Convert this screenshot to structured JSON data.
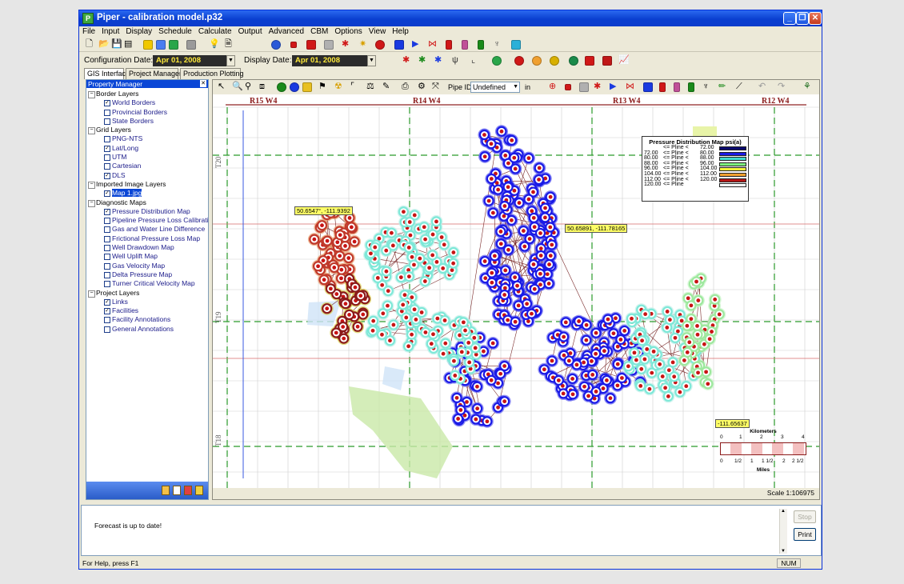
{
  "window": {
    "title": "Piper - calibration model.p32",
    "app_icon": "P"
  },
  "menu": [
    "File",
    "Input",
    "Display",
    "Schedule",
    "Calculate",
    "Output",
    "Advanced",
    "CBM",
    "Options",
    "View",
    "Help"
  ],
  "config": {
    "configuration_label": "Configuration Date:",
    "configuration_date": "Apr 01, 2008",
    "display_label": "Display Date:",
    "display_date": "Apr 01, 2008"
  },
  "tabs": [
    "GIS Interface",
    "Project Manager",
    "Production Plotting"
  ],
  "property_manager": {
    "title": "Property Manager",
    "groups": [
      {
        "label": "Border Layers",
        "items": [
          {
            "label": "World Borders",
            "checked": true
          },
          {
            "label": "Provincial Borders",
            "checked": false
          },
          {
            "label": "State Borders",
            "checked": false
          }
        ]
      },
      {
        "label": "Grid Layers",
        "items": [
          {
            "label": "PNG-NTS",
            "checked": false
          },
          {
            "label": "Lat/Long",
            "checked": true
          },
          {
            "label": "UTM",
            "checked": false
          },
          {
            "label": "Cartesian",
            "checked": false
          },
          {
            "label": "DLS",
            "checked": true
          }
        ]
      },
      {
        "label": "Imported Image Layers",
        "items": [
          {
            "label": "Map 1.jpg",
            "checked": true,
            "selected": true
          }
        ]
      },
      {
        "label": "Diagnostic Maps",
        "items": [
          {
            "label": "Pressure Distribution Map",
            "checked": true
          },
          {
            "label": "Pipeline Pressure Loss Calibration",
            "checked": false
          },
          {
            "label": "Gas and Water Line Difference",
            "checked": false
          },
          {
            "label": "Frictional Pressure Loss Map",
            "checked": false
          },
          {
            "label": "Well Drawdown Map",
            "checked": false
          },
          {
            "label": "Well Uplift Map",
            "checked": false
          },
          {
            "label": "Gas Velocity Map",
            "checked": false
          },
          {
            "label": "Delta Pressure Map",
            "checked": false
          },
          {
            "label": "Turner Critical Velocity Map",
            "checked": false
          }
        ]
      },
      {
        "label": "Project Layers",
        "items": [
          {
            "label": "Links",
            "checked": true
          },
          {
            "label": "Facilities",
            "checked": true
          },
          {
            "label": "Facility Annotations",
            "checked": false
          },
          {
            "label": "General Annotations",
            "checked": false
          }
        ]
      }
    ]
  },
  "map_toolbar": {
    "pipe_id_label": "Pipe ID:",
    "pipe_id_value": "Undefined",
    "unit": "in"
  },
  "map": {
    "range_labels": [
      "R15 W4",
      "R14 W4",
      "R13 W4",
      "R12 W4"
    ],
    "township_labels": [
      "T20",
      "T19",
      "T18"
    ],
    "coord_labels": [
      "50.6547°, -111.9392",
      "50.65891, -111.78165",
      "-111.65637"
    ],
    "scale_text": "Scale 1:106975"
  },
  "legend": {
    "title": "Pressure Distribution Map psi(a)",
    "rows": [
      {
        "from": "",
        "op": "<= Pline <",
        "to": "72.00",
        "color": "#0a0a6e"
      },
      {
        "from": "72.00",
        "op": "<= Pline <",
        "to": "80.00",
        "color": "#1a1ae6"
      },
      {
        "from": "80.00",
        "op": "<= Pline <",
        "to": "88.00",
        "color": "#3fd8d0"
      },
      {
        "from": "88.00",
        "op": "<= Pline <",
        "to": "96.00",
        "color": "#7ef07e"
      },
      {
        "from": "96.00",
        "op": "<= Pline <",
        "to": "104.00",
        "color": "#f2f23a"
      },
      {
        "from": "104.00",
        "op": "<= Pline <",
        "to": "112.00",
        "color": "#f0a030"
      },
      {
        "from": "112.00",
        "op": "<= Pline <",
        "to": "120.00",
        "color": "#b31515"
      },
      {
        "from": "120.00",
        "op": "<= Pline",
        "to": "",
        "color": "#ffffff"
      }
    ]
  },
  "scalebar": {
    "km_title": "Kilometers",
    "km_ticks": [
      "0",
      "1",
      "2",
      "3",
      "4"
    ],
    "mile_title": "Miles",
    "mile_ticks": [
      "0",
      "1/2",
      "1",
      "1 1/2",
      "2",
      "2 1/2"
    ]
  },
  "console": {
    "message": "Forecast is up to date!",
    "stop_label": "Stop",
    "print_label": "Print"
  },
  "status": {
    "help": "For Help, press F1",
    "num": "NUM"
  },
  "colors": {
    "titlebar": "#0a3fd0",
    "low_pressure": "#1a1ae6",
    "mid_pressure": "#3fd8d0",
    "high_pressure": "#b31515"
  }
}
